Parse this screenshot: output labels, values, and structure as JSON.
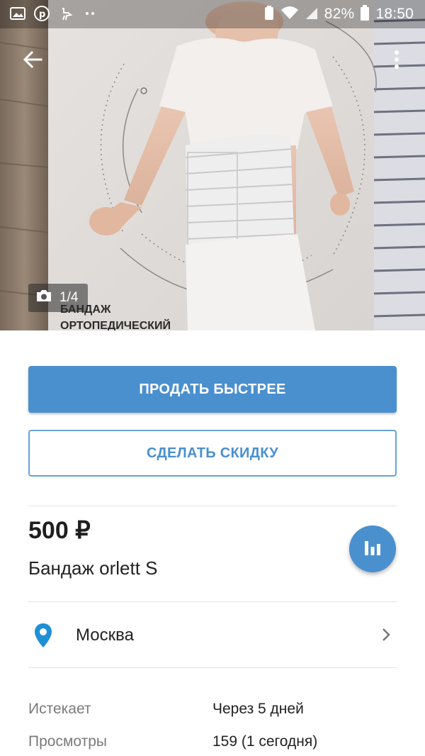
{
  "status_bar": {
    "battery": "82%",
    "time": "18:50"
  },
  "gallery": {
    "counter": "1/4",
    "box_text_line1": "БАНДАЖ",
    "box_text_line2": "ОРТОПЕДИЧЕСКИЙ"
  },
  "actions": {
    "sell_faster": "ПРОДАТЬ БЫСТРЕЕ",
    "make_discount": "СДЕЛАТЬ СКИДКУ"
  },
  "listing": {
    "price": "500 ₽",
    "title": "Бандаж orlett S",
    "location": "Москва"
  },
  "stats": [
    {
      "label": "Истекает",
      "value": "Через 5 дней"
    },
    {
      "label": "Просмотры",
      "value": "159 (1 сегодня)"
    }
  ],
  "colors": {
    "accent": "#4a90cf",
    "location_pin": "#1e90d6"
  },
  "icons": {
    "back": "arrow-left-icon",
    "menu": "more-vert-icon",
    "camera": "camera-icon",
    "stats": "bar-chart-icon",
    "location": "map-pin-icon",
    "chevron": "chevron-right-icon"
  }
}
